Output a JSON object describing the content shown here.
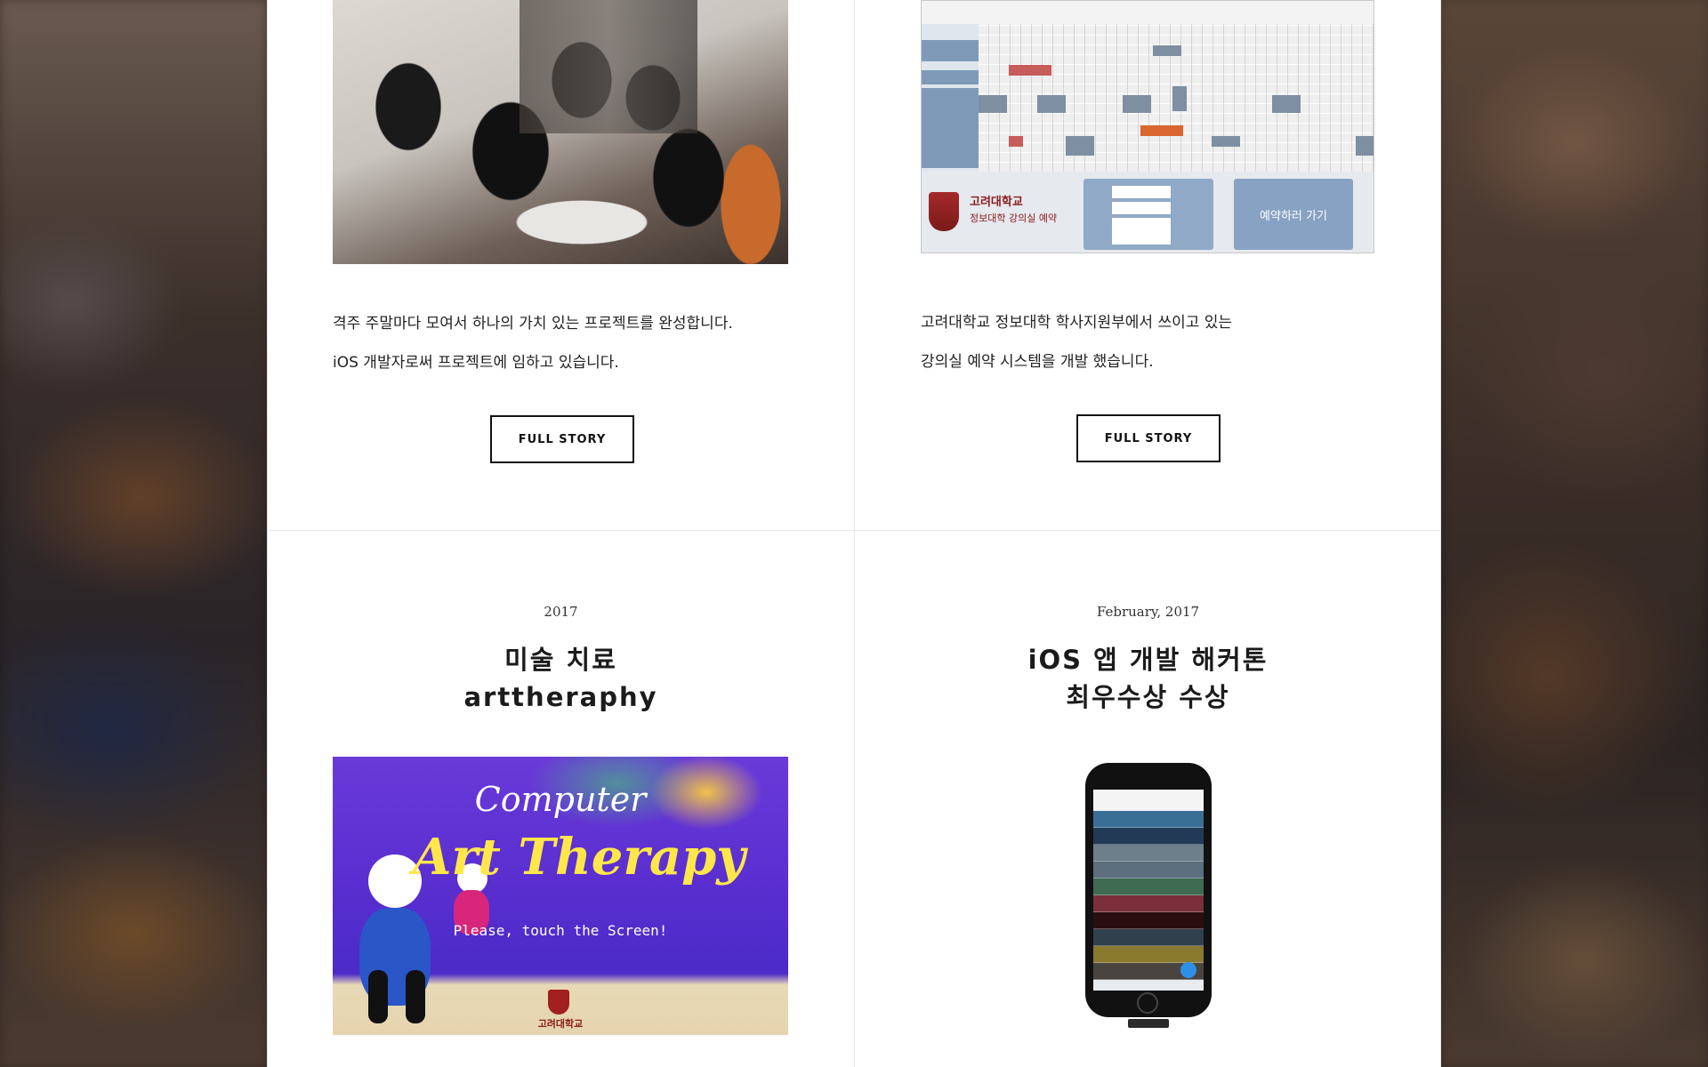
{
  "cards": {
    "top_left": {
      "desc_lines": [
        "격주 주말마다 모여서 하나의 가치 있는 프로젝트를 완성합니다.",
        "iOS 개발자로써 프로젝트에 임하고 있습니다."
      ],
      "button": "FULL STORY"
    },
    "top_right": {
      "screenshot": {
        "university": "고려대학교",
        "system_name": "정보대학 강의실 예약",
        "reserve_button": "예약하러 가기"
      },
      "desc_lines": [
        "고려대학교 정보대학 학사지원부에서 쓰이고 있는",
        "강의실 예약 시스템을 개발 했습니다."
      ],
      "button": "FULL STORY"
    },
    "bottom_left": {
      "date": "2017",
      "title_lines": [
        "미술 치료",
        "arttheraphy"
      ],
      "image": {
        "line1": "Computer",
        "line2": "Art Therapy",
        "line3": "Please, touch the Screen!",
        "logo_text": "고려대학교"
      }
    },
    "bottom_right": {
      "date": "February, 2017",
      "title_lines": [
        "iOS 앱 개발 해커톤",
        "최우수상 수상"
      ]
    }
  },
  "colors": {
    "button_border": "#111111",
    "divider": "#e9e9e9",
    "art_purple": "#5a2ed0",
    "art_yellow": "#ffe74a",
    "korea_univ_red": "#8a1b1b"
  }
}
